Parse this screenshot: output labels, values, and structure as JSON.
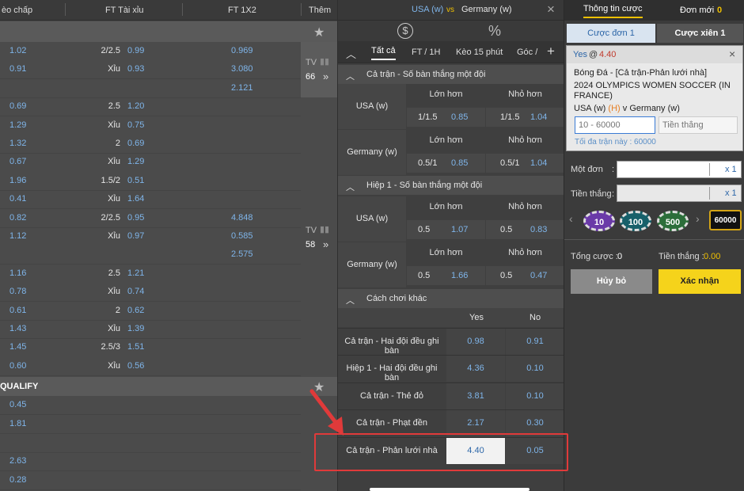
{
  "left": {
    "headers": {
      "handicap": "èo chấp",
      "ou": "FT Tài xỉu",
      "x12": "FT 1X2",
      "more": "Thêm"
    },
    "rows": [
      {
        "h": "1.02",
        "ou_line": "2/2.5",
        "ou": "0.99",
        "x": "0.969"
      },
      {
        "h": "0.91",
        "ou_line": "Xỉu",
        "ou": "0.93",
        "x": "3.080"
      },
      {
        "h": "",
        "ou_line": "",
        "ou": "",
        "x": "2.121"
      },
      {
        "h": "0.69",
        "ou_line": "2.5",
        "ou": "1.20",
        "x": ""
      },
      {
        "h": "1.29",
        "ou_line": "Xỉu",
        "ou": "0.75",
        "x": ""
      },
      {
        "h": "1.32",
        "ou_line": "2",
        "ou": "0.69",
        "x": ""
      },
      {
        "h": "0.67",
        "ou_line": "Xỉu",
        "ou": "1.29",
        "x": ""
      },
      {
        "h": "1.96",
        "ou_line": "1.5/2",
        "ou": "0.51",
        "x": ""
      },
      {
        "h": "0.41",
        "ou_line": "Xỉu",
        "ou": "1.64",
        "x": ""
      },
      {
        "h": "0.82",
        "ou_line": "2/2.5",
        "ou": "0.95",
        "x": "4.848"
      },
      {
        "h": "1.12",
        "ou_line": "Xỉu",
        "ou": "0.97",
        "x": "0.585"
      },
      {
        "h": "",
        "ou_line": "",
        "ou": "",
        "x": "2.575"
      },
      {
        "h": "1.16",
        "ou_line": "2.5",
        "ou": "1.21",
        "x": ""
      },
      {
        "h": "0.78",
        "ou_line": "Xỉu",
        "ou": "0.74",
        "x": ""
      },
      {
        "h": "0.61",
        "ou_line": "2",
        "ou": "0.62",
        "x": ""
      },
      {
        "h": "1.43",
        "ou_line": "Xỉu",
        "ou": "1.39",
        "x": ""
      },
      {
        "h": "1.45",
        "ou_line": "2.5/3",
        "ou": "1.51",
        "x": ""
      },
      {
        "h": "0.60",
        "ou_line": "Xỉu",
        "ou": "0.56",
        "x": ""
      }
    ],
    "tv1": {
      "label": "TV",
      "count": "66"
    },
    "tv2": {
      "label": "TV",
      "count": "58"
    },
    "section2": "QUALIFY",
    "rows2": [
      {
        "h": "0.45"
      },
      {
        "h": "1.81"
      },
      {
        "h": ""
      },
      {
        "h": "2.63"
      },
      {
        "h": "0.28"
      }
    ]
  },
  "mid": {
    "home": "USA (w)",
    "vs": "vs",
    "away": "Germany (w)",
    "tabs": [
      "Tất cả",
      "FT / 1H",
      "Kèo 15 phút",
      "Góc /"
    ],
    "sec1": "Cả trận - Số bàn thắng một đội",
    "sec2": "Hiệp 1 - Số bàn thắng một đội",
    "sec3": "Cách chơi khác",
    "over": "Lớn hơn",
    "under": "Nhỏ hơn",
    "s1": [
      {
        "team": "USA (w)",
        "ol": "1/1.5",
        "ov": "0.85",
        "ul": "1/1.5",
        "uv": "1.04"
      },
      {
        "team": "Germany (w)",
        "ol": "0.5/1",
        "ov": "0.85",
        "ul": "0.5/1",
        "uv": "1.04"
      }
    ],
    "s2": [
      {
        "team": "USA (w)",
        "ol": "0.5",
        "ov": "1.07",
        "ul": "0.5",
        "uv": "0.83"
      },
      {
        "team": "Germany (w)",
        "ol": "0.5",
        "ov": "1.66",
        "ul": "0.5",
        "uv": "0.47"
      }
    ],
    "yes": "Yes",
    "no": "No",
    "others": [
      {
        "name": "Cả trận - Hai đội đều ghi bàn",
        "y": "0.98",
        "n": "0.91"
      },
      {
        "name": "Hiệp 1 - Hai đội đều ghi bàn",
        "y": "4.36",
        "n": "0.10"
      },
      {
        "name": "Cả trận - Thẻ đỏ",
        "y": "3.81",
        "n": "0.10"
      },
      {
        "name": "Cả trận - Phạt đền",
        "y": "2.17",
        "n": "0.30"
      },
      {
        "name": "Cả trận - Phản lưới nhà",
        "y": "4.40",
        "n": "0.05"
      }
    ]
  },
  "right": {
    "tab_info": "Thông tin cược",
    "tab_new": "Đơn mới",
    "new_count": "0",
    "single": "Cược đơn 1",
    "parlay": "Cược xiên 1",
    "pick": "Yes",
    "at": "@",
    "odds": "4.40",
    "sport": "Bóng Đá - [Cả trận-Phản lưới nhà]",
    "league": "2024 OLYMPICS WOMEN SOCCER (IN FRANCE)",
    "m_home": "USA (w)",
    "m_h": "(H)",
    "m_v": "v",
    "m_away": "Germany (w)",
    "stake_ph": "10 - 60000",
    "win_ph": "Tiền thắng",
    "max": "Tối đa trận này : 60000",
    "single_lbl": "Một đơn",
    "win_lbl": "Tiền thắng",
    "colon": ":",
    "x1": "x 1",
    "chips": [
      "10",
      "100",
      "500",
      "60000"
    ],
    "total_lbl": "Tổng cược :",
    "total": "0",
    "towin_lbl": "Tiền thắng :",
    "towin": "0.00",
    "cancel": "Hủy bỏ",
    "confirm": "Xác nhận"
  }
}
